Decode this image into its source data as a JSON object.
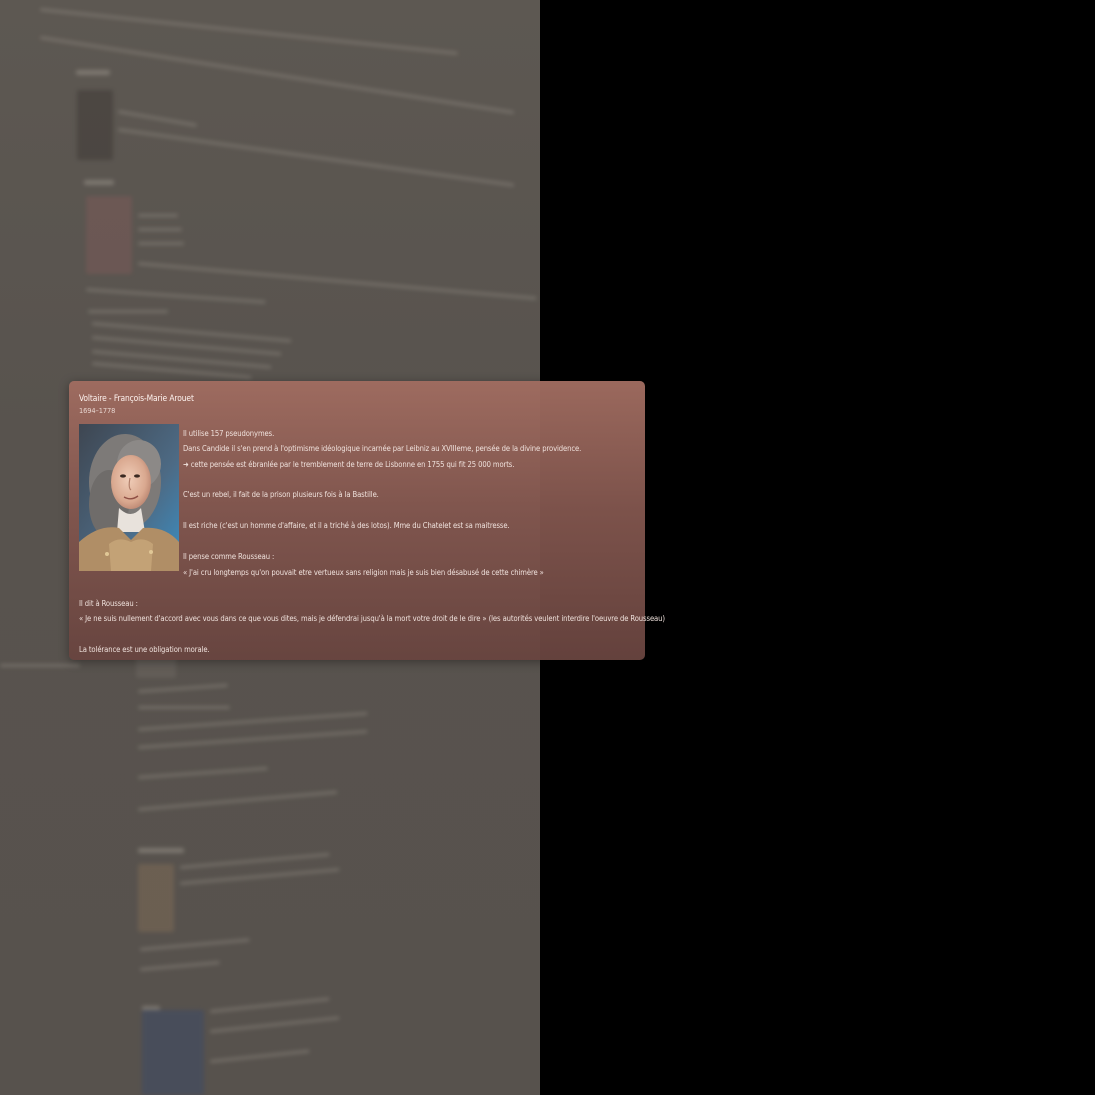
{
  "card": {
    "name": "Voltaire - François-Marie Arouet",
    "dates": "1694–1778",
    "lines": [
      "Il utilise 157 pseudonymes.",
      "Dans Candide il s'en prend à l'optimisme idéologique incarnée par Leibniz au XVIIIeme, pensée de la divine providence.",
      "➜ cette pensée est ébranlée par le tremblement de terre de Lisbonne en  1755 qui fit 25 000 morts.",
      "C'est un rebel, il fait de la prison plusieurs fois à la Bastille.",
      "Il est riche (c'est un homme d'affaire, et il a triché à des lotos). Mme du Chatelet est sa maitresse.",
      "Il pense comme Rousseau :",
      "« J'ai cru longtemps qu'on pouvait etre vertueux sans religion mais je suis bien désabusé de cette chimère »",
      "Il dit à Rousseau :",
      "« Je ne suis nullement d'accord avec vous dans ce que vous dites, mais je défendrai jusqu'à la mort votre droit de le dire » (les autorités veulent interdire l'oeuvre de Rousseau)",
      "La tolérance est une obligation morale."
    ]
  },
  "colors": {
    "card_top": "#a06c60",
    "card_bottom": "#68443f",
    "background_page": "#5b5650",
    "outer_background": "#000000"
  }
}
